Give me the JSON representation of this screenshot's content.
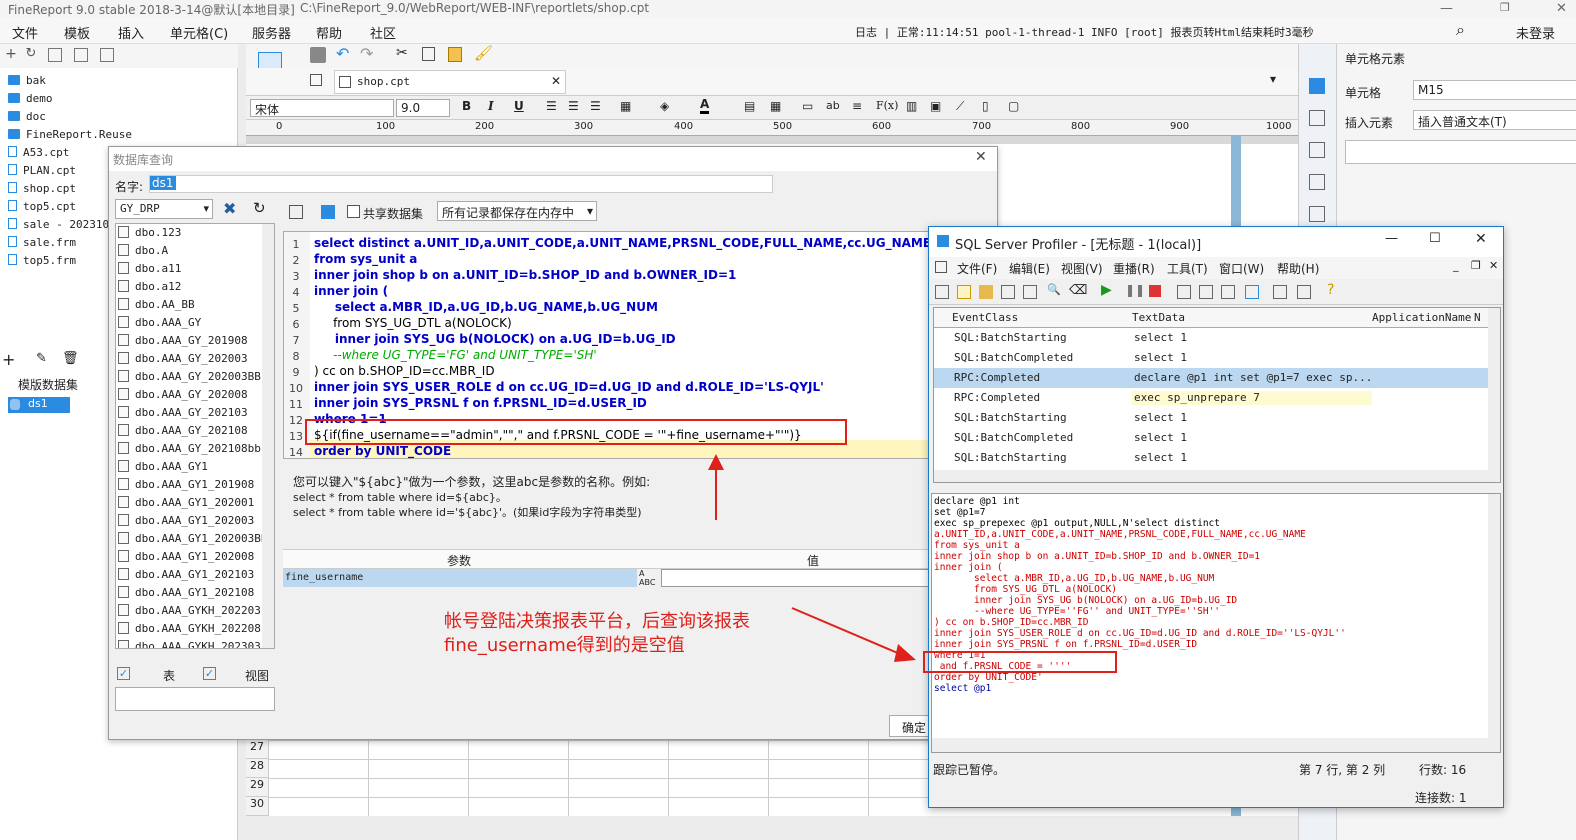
{
  "titlebar": {
    "app": "FineReport 9.0 stable 2018-3-14@默认[本地目录]",
    "path": "C:\\FineReport_9.0/WebReport/WEB-INF\\reportlets/shop.cpt"
  },
  "menu": [
    "文件",
    "模板",
    "插入",
    "单元格(C)",
    "服务器",
    "帮助",
    "社区"
  ],
  "log": "日志 | 正常:11:14:51 pool-1-thread-1 INFO [root] 报表页转Html结束耗时3毫秒",
  "login": "未登录",
  "files": [
    {
      "name": "bak",
      "type": "folder"
    },
    {
      "name": "demo",
      "type": "folder"
    },
    {
      "name": "doc",
      "type": "folder"
    },
    {
      "name": "FineReport.Reuse",
      "type": "folder"
    },
    {
      "name": "A53.cpt",
      "type": "doc"
    },
    {
      "name": "PLAN.cpt",
      "type": "doc"
    },
    {
      "name": "shop.cpt",
      "type": "doc"
    },
    {
      "name": "top5.cpt",
      "type": "doc"
    },
    {
      "name": "sale - 2023102",
      "type": "doc"
    },
    {
      "name": "sale.frm",
      "type": "doc"
    },
    {
      "name": "top5.frm",
      "type": "doc"
    }
  ],
  "template_ds_label": "模版数据集",
  "template_ds_item": "ds1",
  "tab_name": "shop.cpt",
  "font_name": "宋体",
  "font_size": "9.0",
  "ruler": [
    "0",
    "100",
    "200",
    "300",
    "400",
    "500",
    "600",
    "700",
    "800",
    "900",
    "1000"
  ],
  "rows_bottom": [
    "27",
    "28",
    "29",
    "30"
  ],
  "right_panel": {
    "title": "单元格元素",
    "cell_label": "单元格",
    "cell_value": "M15",
    "insert_label": "插入元素",
    "insert_value": "插入普通文本(T)"
  },
  "db_dialog": {
    "title": "数据库查询",
    "name_label": "名字:",
    "name_value": "ds1",
    "connection": "GY_DRP",
    "share_label": "共享数据集",
    "memory_option": "所有记录都保存在内存中",
    "tables": [
      "dbo.123",
      "dbo.A",
      "dbo.a11",
      "dbo.a12",
      "dbo.AA_BB",
      "dbo.AAA_GY",
      "dbo.AAA_GY_201908",
      "dbo.AAA_GY_202003",
      "dbo.AAA_GY_202003BB",
      "dbo.AAA_GY_202008",
      "dbo.AAA_GY_202103",
      "dbo.AAA_GY_202108",
      "dbo.AAA_GY_202108bb",
      "dbo.AAA_GY1",
      "dbo.AAA_GY1_201908",
      "dbo.AAA_GY1_202001",
      "dbo.AAA_GY1_202003",
      "dbo.AAA_GY1_202003BB",
      "dbo.AAA_GY1_202008",
      "dbo.AAA_GY1_202103",
      "dbo.AAA_GY1_202108",
      "dbo.AAA_GYKH_202203",
      "dbo.AAA_GYKH_202208",
      "dbo.AAA_GYKH_202303"
    ],
    "check_table": "表",
    "check_view": "视图",
    "line_numbers": [
      "1",
      "2",
      "3",
      "4",
      "5",
      "6",
      "7",
      "8",
      "9",
      "10",
      "11",
      "12",
      "13",
      "14"
    ],
    "code": [
      "select distinct a.UNIT_ID,a.UNIT_CODE,a.UNIT_NAME,PRSNL_CODE,FULL_NAME,cc.UG_NAME",
      "from sys_unit a",
      "inner join shop b on a.UNIT_ID=b.SHOP_ID and b.OWNER_ID=1",
      "inner join (",
      "     select a.MBR_ID,a.UG_ID,b.UG_NAME,b.UG_NUM",
      "     from SYS_UG_DTL a(NOLOCK)",
      "     inner join SYS_UG b(NOLOCK) on a.UG_ID=b.UG_ID",
      "     --where UG_TYPE='FG' and UNIT_TYPE='SH'",
      ") cc on b.SHOP_ID=cc.MBR_ID",
      "inner join SYS_USER_ROLE d on cc.UG_ID=d.UG_ID and d.ROLE_ID='LS-QYJL'",
      "inner join SYS_PRSNL f on f.PRSNL_ID=d.USER_ID",
      "where 1=1",
      "${if(fine_username==\"admin\",\"\",\" and f.PRSNL_CODE = '\"+fine_username+\"'\")}",
      "order by UNIT_CODE"
    ],
    "hint": [
      "您可以键入\"${abc}\"做为一个参数，这里abc是参数的名称。例如:",
      "select * from table where id=${abc}。",
      "select * from table where id='${abc}'。(如果id字段为字符串类型)"
    ],
    "param_header": "参数",
    "value_header": "值",
    "param_name": "fine_username",
    "ok_button": "确定"
  },
  "profiler": {
    "title": "SQL Server Profiler - [无标题 - 1(local)]",
    "menu": [
      "文件(F)",
      "编辑(E)",
      "视图(V)",
      "重播(R)",
      "工具(T)",
      "窗口(W)",
      "帮助(H)"
    ],
    "columns": [
      "EventClass",
      "TextData",
      "ApplicationName",
      "N"
    ],
    "events": [
      {
        "cls": "SQL:BatchStarting",
        "text": "select 1"
      },
      {
        "cls": "SQL:BatchCompleted",
        "text": "select 1"
      },
      {
        "cls": "RPC:Completed",
        "text": "declare @p1 int  set @p1=7  exec sp..."
      },
      {
        "cls": "RPC:Completed",
        "text": "exec sp_unprepare 7"
      },
      {
        "cls": "SQL:BatchStarting",
        "text": "select 1"
      },
      {
        "cls": "SQL:BatchCompleted",
        "text": "select 1"
      },
      {
        "cls": "SQL:BatchStarting",
        "text": "select 1"
      }
    ],
    "sql": [
      "declare @p1 int",
      "set @p1=7",
      "exec sp_prepexec @p1 output,NULL,N'select distinct",
      "a.UNIT_ID,a.UNIT_CODE,a.UNIT_NAME,PRSNL_CODE,FULL_NAME,cc.UG_NAME",
      "from sys_unit a",
      "inner join shop b on a.UNIT_ID=b.SHOP_ID and b.OWNER_ID=1",
      "inner join (",
      "       select a.MBR_ID,a.UG_ID,b.UG_NAME,b.UG_NUM",
      "       from SYS_UG_DTL a(NOLOCK)",
      "       inner join SYS_UG b(NOLOCK) on a.UG_ID=b.UG_ID",
      "       --where UG_TYPE=''FG'' and UNIT_TYPE=''SH''",
      ") cc on b.SHOP_ID=cc.MBR_ID",
      "inner join SYS_USER_ROLE d on cc.UG_ID=d.UG_ID and d.ROLE_ID=''LS-QYJL''",
      "inner join SYS_PRSNL f on f.PRSNL_ID=d.USER_ID",
      "where 1=1",
      " and f.PRSNL_CODE = ''''",
      "order by UNIT_CODE'",
      "select @p1"
    ],
    "status_left": "跟踪已暂停。",
    "status_pos": "第 7 行, 第 2 列",
    "status_rows": "行数: 16",
    "status_conn": "连接数: 1"
  },
  "annotation": {
    "line1": "帐号登陆决策报表平台，后查询该报表",
    "line2": "fine_username得到的是空值"
  },
  "colors": {
    "accent": "#2a8be0",
    "annotation": "#e0201a",
    "selected_row": "#bcd8f0"
  }
}
